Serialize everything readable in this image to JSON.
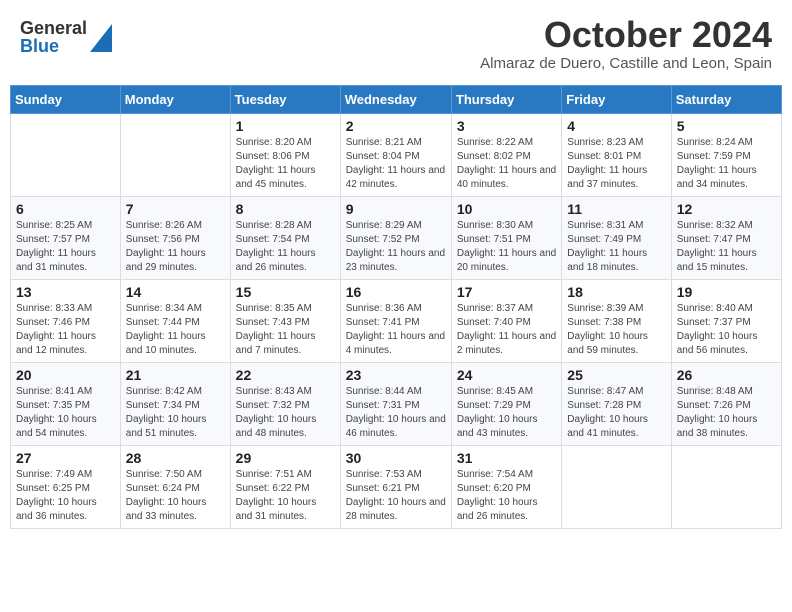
{
  "header": {
    "logo_general": "General",
    "logo_blue": "Blue",
    "title": "October 2024",
    "location": "Almaraz de Duero, Castille and Leon, Spain"
  },
  "days_of_week": [
    "Sunday",
    "Monday",
    "Tuesday",
    "Wednesday",
    "Thursday",
    "Friday",
    "Saturday"
  ],
  "weeks": [
    [
      {
        "day": "",
        "detail": ""
      },
      {
        "day": "",
        "detail": ""
      },
      {
        "day": "1",
        "detail": "Sunrise: 8:20 AM\nSunset: 8:06 PM\nDaylight: 11 hours and 45 minutes."
      },
      {
        "day": "2",
        "detail": "Sunrise: 8:21 AM\nSunset: 8:04 PM\nDaylight: 11 hours and 42 minutes."
      },
      {
        "day": "3",
        "detail": "Sunrise: 8:22 AM\nSunset: 8:02 PM\nDaylight: 11 hours and 40 minutes."
      },
      {
        "day": "4",
        "detail": "Sunrise: 8:23 AM\nSunset: 8:01 PM\nDaylight: 11 hours and 37 minutes."
      },
      {
        "day": "5",
        "detail": "Sunrise: 8:24 AM\nSunset: 7:59 PM\nDaylight: 11 hours and 34 minutes."
      }
    ],
    [
      {
        "day": "6",
        "detail": "Sunrise: 8:25 AM\nSunset: 7:57 PM\nDaylight: 11 hours and 31 minutes."
      },
      {
        "day": "7",
        "detail": "Sunrise: 8:26 AM\nSunset: 7:56 PM\nDaylight: 11 hours and 29 minutes."
      },
      {
        "day": "8",
        "detail": "Sunrise: 8:28 AM\nSunset: 7:54 PM\nDaylight: 11 hours and 26 minutes."
      },
      {
        "day": "9",
        "detail": "Sunrise: 8:29 AM\nSunset: 7:52 PM\nDaylight: 11 hours and 23 minutes."
      },
      {
        "day": "10",
        "detail": "Sunrise: 8:30 AM\nSunset: 7:51 PM\nDaylight: 11 hours and 20 minutes."
      },
      {
        "day": "11",
        "detail": "Sunrise: 8:31 AM\nSunset: 7:49 PM\nDaylight: 11 hours and 18 minutes."
      },
      {
        "day": "12",
        "detail": "Sunrise: 8:32 AM\nSunset: 7:47 PM\nDaylight: 11 hours and 15 minutes."
      }
    ],
    [
      {
        "day": "13",
        "detail": "Sunrise: 8:33 AM\nSunset: 7:46 PM\nDaylight: 11 hours and 12 minutes."
      },
      {
        "day": "14",
        "detail": "Sunrise: 8:34 AM\nSunset: 7:44 PM\nDaylight: 11 hours and 10 minutes."
      },
      {
        "day": "15",
        "detail": "Sunrise: 8:35 AM\nSunset: 7:43 PM\nDaylight: 11 hours and 7 minutes."
      },
      {
        "day": "16",
        "detail": "Sunrise: 8:36 AM\nSunset: 7:41 PM\nDaylight: 11 hours and 4 minutes."
      },
      {
        "day": "17",
        "detail": "Sunrise: 8:37 AM\nSunset: 7:40 PM\nDaylight: 11 hours and 2 minutes."
      },
      {
        "day": "18",
        "detail": "Sunrise: 8:39 AM\nSunset: 7:38 PM\nDaylight: 10 hours and 59 minutes."
      },
      {
        "day": "19",
        "detail": "Sunrise: 8:40 AM\nSunset: 7:37 PM\nDaylight: 10 hours and 56 minutes."
      }
    ],
    [
      {
        "day": "20",
        "detail": "Sunrise: 8:41 AM\nSunset: 7:35 PM\nDaylight: 10 hours and 54 minutes."
      },
      {
        "day": "21",
        "detail": "Sunrise: 8:42 AM\nSunset: 7:34 PM\nDaylight: 10 hours and 51 minutes."
      },
      {
        "day": "22",
        "detail": "Sunrise: 8:43 AM\nSunset: 7:32 PM\nDaylight: 10 hours and 48 minutes."
      },
      {
        "day": "23",
        "detail": "Sunrise: 8:44 AM\nSunset: 7:31 PM\nDaylight: 10 hours and 46 minutes."
      },
      {
        "day": "24",
        "detail": "Sunrise: 8:45 AM\nSunset: 7:29 PM\nDaylight: 10 hours and 43 minutes."
      },
      {
        "day": "25",
        "detail": "Sunrise: 8:47 AM\nSunset: 7:28 PM\nDaylight: 10 hours and 41 minutes."
      },
      {
        "day": "26",
        "detail": "Sunrise: 8:48 AM\nSunset: 7:26 PM\nDaylight: 10 hours and 38 minutes."
      }
    ],
    [
      {
        "day": "27",
        "detail": "Sunrise: 7:49 AM\nSunset: 6:25 PM\nDaylight: 10 hours and 36 minutes."
      },
      {
        "day": "28",
        "detail": "Sunrise: 7:50 AM\nSunset: 6:24 PM\nDaylight: 10 hours and 33 minutes."
      },
      {
        "day": "29",
        "detail": "Sunrise: 7:51 AM\nSunset: 6:22 PM\nDaylight: 10 hours and 31 minutes."
      },
      {
        "day": "30",
        "detail": "Sunrise: 7:53 AM\nSunset: 6:21 PM\nDaylight: 10 hours and 28 minutes."
      },
      {
        "day": "31",
        "detail": "Sunrise: 7:54 AM\nSunset: 6:20 PM\nDaylight: 10 hours and 26 minutes."
      },
      {
        "day": "",
        "detail": ""
      },
      {
        "day": "",
        "detail": ""
      }
    ]
  ]
}
